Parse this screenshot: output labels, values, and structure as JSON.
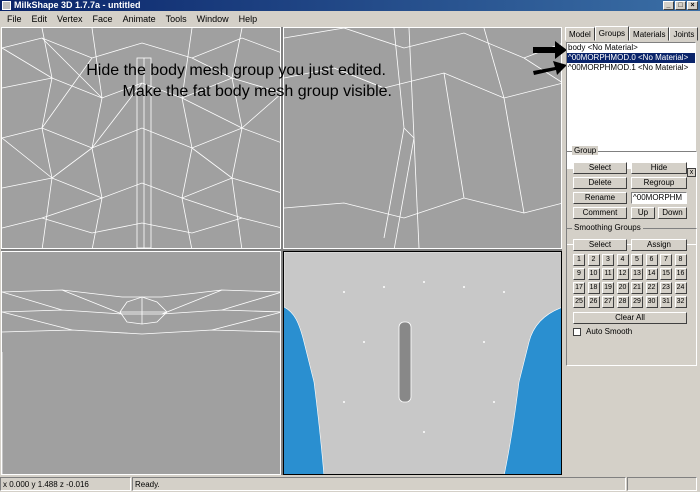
{
  "window": {
    "title": "MilkShape 3D 1.7.7a - untitled"
  },
  "menu": [
    "File",
    "Edit",
    "Vertex",
    "Face",
    "Animate",
    "Tools",
    "Window",
    "Help"
  ],
  "annotations": {
    "line1": "Hide the body mesh group you just edited.",
    "line2": "Make the fat body mesh group visible."
  },
  "panel": {
    "tabs": [
      "Model",
      "Groups",
      "Materials",
      "Joints"
    ],
    "active_tab": "Groups",
    "groups": [
      {
        "label": "body <No Material>",
        "selected": false
      },
      {
        "label": "^00MORPHMOD.0 <No Material>",
        "selected": true
      },
      {
        "label": "^00MORPHMOD.1 <No Material>",
        "selected": false
      }
    ],
    "close_label": "x",
    "group_section": {
      "title": "Group",
      "select": "Select",
      "hide": "Hide",
      "delete": "Delete",
      "regroup": "Regroup",
      "rename": "Rename",
      "name_value": "^00MORPHM",
      "comment": "Comment",
      "up": "Up",
      "down": "Down"
    },
    "smoothing": {
      "title": "Smoothing Groups",
      "select": "Select",
      "assign": "Assign",
      "numbers": [
        "1",
        "2",
        "3",
        "4",
        "5",
        "6",
        "7",
        "8",
        "9",
        "10",
        "11",
        "12",
        "13",
        "14",
        "15",
        "16",
        "17",
        "18",
        "19",
        "20",
        "21",
        "22",
        "23",
        "24",
        "25",
        "26",
        "27",
        "28",
        "29",
        "30",
        "31",
        "32"
      ],
      "clear_all": "Clear All",
      "auto_smooth": "Auto Smooth",
      "auto_smooth_checked": false
    }
  },
  "status": {
    "coords": "x 0.000 y 1.488 z -0.016",
    "message": "Ready."
  }
}
